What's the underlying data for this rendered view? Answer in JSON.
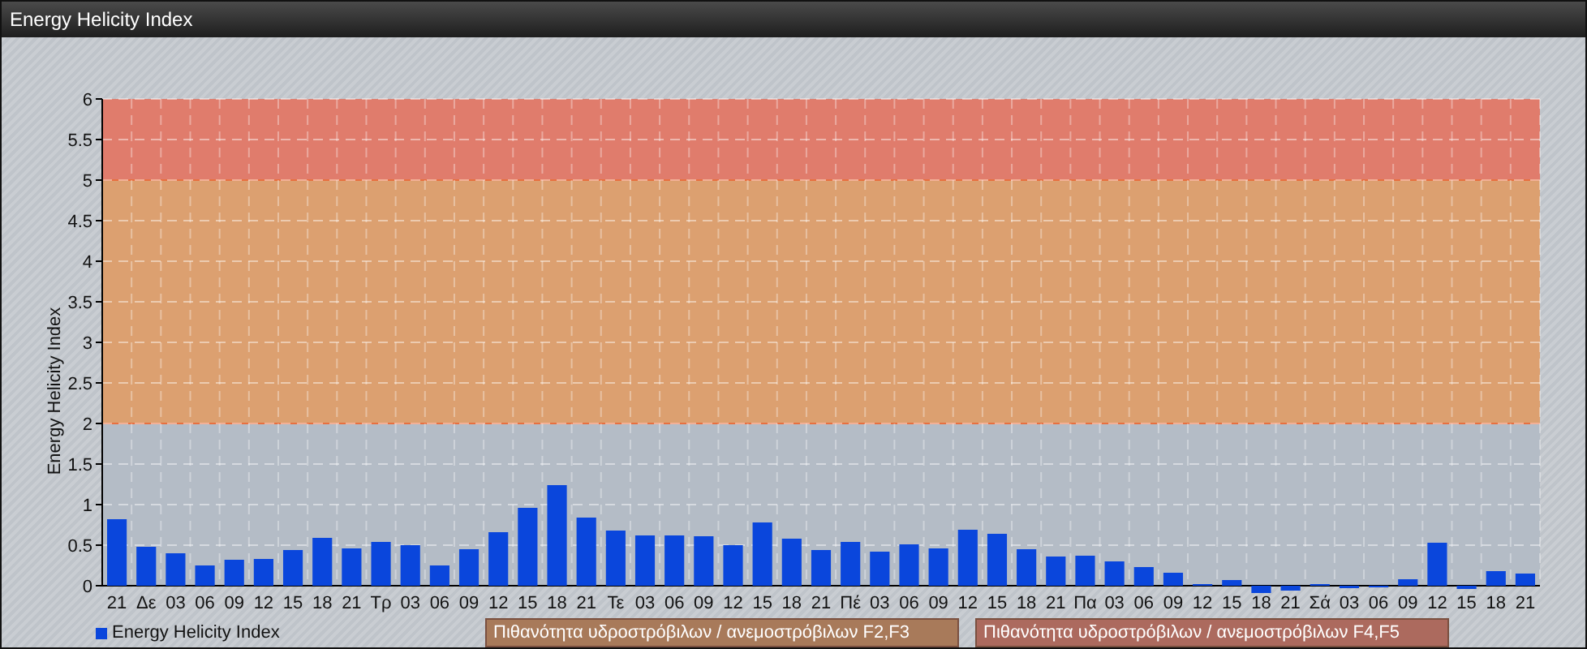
{
  "window": {
    "title": "Energy Helicity Index"
  },
  "chart": {
    "chart_data": {
      "type": "bar",
      "ylabel": "Energy Helicity Index",
      "ylim": [
        -0.1,
        6
      ],
      "grid": true,
      "yticks": [
        0,
        0.5,
        1,
        1.5,
        2,
        2.5,
        3,
        3.5,
        4,
        4.5,
        5,
        5.5,
        6
      ],
      "categories": [
        "21",
        "Δε",
        "03",
        "06",
        "09",
        "12",
        "15",
        "18",
        "21",
        "Τρ",
        "03",
        "06",
        "09",
        "12",
        "15",
        "18",
        "21",
        "Τε",
        "03",
        "06",
        "09",
        "12",
        "15",
        "18",
        "21",
        "Πέ",
        "03",
        "06",
        "09",
        "12",
        "15",
        "18",
        "21",
        "Πα",
        "03",
        "06",
        "09",
        "12",
        "15",
        "18",
        "21",
        "Σά",
        "03",
        "06",
        "09",
        "12",
        "15",
        "18",
        "21"
      ],
      "series": [
        {
          "name": "Energy Helicity Index",
          "color": "#0a46dc",
          "values": [
            0.82,
            0.48,
            0.4,
            0.25,
            0.32,
            0.33,
            0.44,
            0.59,
            0.46,
            0.54,
            0.5,
            0.25,
            0.45,
            0.66,
            0.96,
            1.24,
            0.84,
            0.68,
            0.62,
            0.62,
            0.61,
            0.5,
            0.78,
            0.58,
            0.44,
            0.54,
            0.42,
            0.51,
            0.46,
            0.69,
            0.64,
            0.45,
            0.36,
            0.37,
            0.3,
            0.23,
            0.16,
            0.02,
            0.07,
            -0.09,
            -0.06,
            0.02,
            -0.03,
            -0.02,
            0.08,
            0.53,
            -0.04,
            0.18,
            0.15
          ]
        }
      ],
      "bands": [
        {
          "axis": "y",
          "from": 0,
          "to": 2,
          "color": "#b4bcc6"
        },
        {
          "axis": "y",
          "from": 2,
          "to": 5,
          "color": "#dca070"
        },
        {
          "axis": "y",
          "from": 5,
          "to": 6,
          "color": "#e07c6c"
        }
      ]
    }
  },
  "legend": {
    "zones": [
      {
        "label": "Πιθανότητα υδροστρόβιλων / ανεμοστρόβιλων F2,F3",
        "color": "#a87a5a"
      },
      {
        "label": "Πιθανότητα υδροστρόβιλων / ανεμοστρόβιλων F4,F5",
        "color": "#ac6a5e"
      }
    ]
  }
}
